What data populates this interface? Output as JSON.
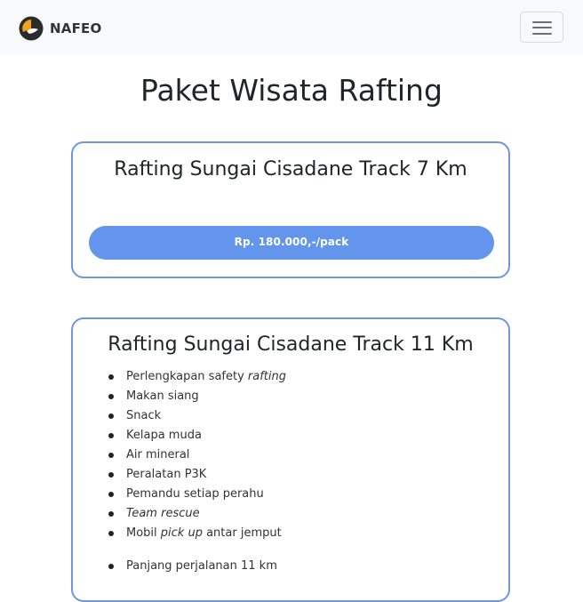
{
  "navbar": {
    "brand_name": "NAFEO"
  },
  "page": {
    "title": "Paket Wisata Rafting"
  },
  "packages": [
    {
      "title": "Rafting Sungai Cisadane Track 7 Km",
      "price_label": "Rp. 180.000,-/pack"
    },
    {
      "title": "Rafting Sungai Cisadane Track 11 Km",
      "features": [
        {
          "prefix": "Perlengkapan safety ",
          "em": "rafting",
          "suffix": ""
        },
        {
          "prefix": "Makan siang",
          "em": "",
          "suffix": ""
        },
        {
          "prefix": "Snack",
          "em": "",
          "suffix": ""
        },
        {
          "prefix": "Kelapa muda",
          "em": "",
          "suffix": ""
        },
        {
          "prefix": "Air mineral",
          "em": "",
          "suffix": ""
        },
        {
          "prefix": "Peralatan P3K",
          "em": "",
          "suffix": ""
        },
        {
          "prefix": "Pemandu setiap perahu",
          "em": "",
          "suffix": ""
        },
        {
          "prefix": "",
          "em": "Team rescue",
          "suffix": ""
        },
        {
          "prefix": "Mobil ",
          "em": "pick up",
          "suffix": " antar jemput"
        },
        {
          "prefix": "Panjang perjalanan 11 km",
          "em": "",
          "suffix": ""
        }
      ]
    }
  ],
  "colors": {
    "accent": "#6495ed",
    "card_border": "#6f95e6",
    "navbar_bg": "#f8f9fa"
  },
  "icons": {
    "brand": "brand-logo-icon",
    "menu": "hamburger-menu-icon"
  }
}
